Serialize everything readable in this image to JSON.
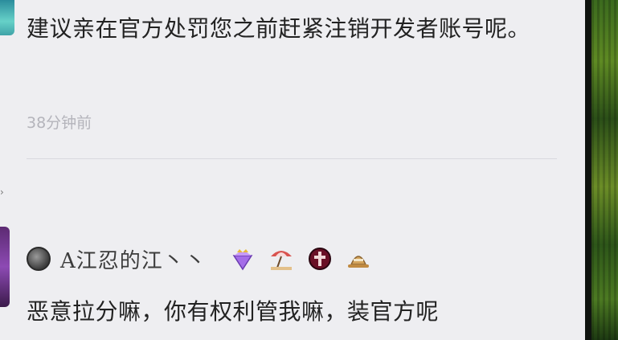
{
  "comments": [
    {
      "text": "建议亲在官方处罚您之前赶紧注销开发者账号呢。",
      "time": "38分钟前"
    },
    {
      "username": "A江忍的江丶丶",
      "text": "恶意拉分嘛，你有权利管我嘛，装官方呢",
      "badges": [
        "purple-gem-crown-badge",
        "beach-umbrella-badge",
        "crimson-cross-badge",
        "straw-hat-badge"
      ]
    }
  ]
}
